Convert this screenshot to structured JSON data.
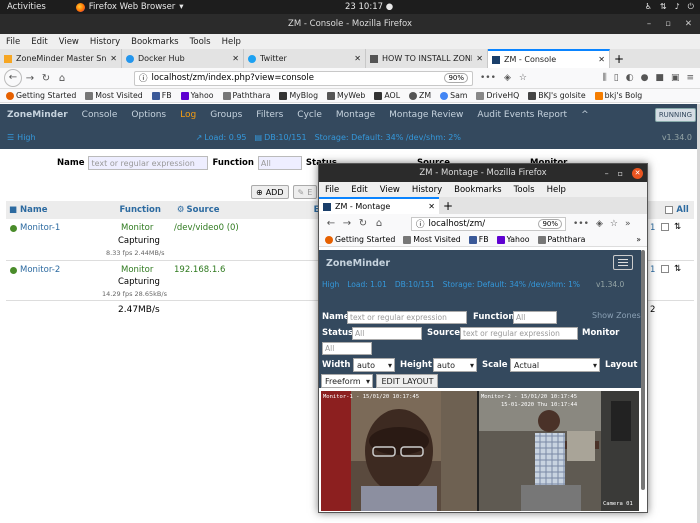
{
  "topbar": {
    "activities": "Activities",
    "app_name": "Firefox Web Browser",
    "clock": "23  10:17 ●",
    "tray_icons": [
      "accessibility-icon",
      "network-icon",
      "volume-icon",
      "power-icon"
    ]
  },
  "main_window": {
    "title": "ZM - Console - Mozilla Firefox",
    "menu": [
      "File",
      "Edit",
      "View",
      "History",
      "Bookmarks",
      "Tools",
      "Help"
    ],
    "tabs": [
      {
        "label": "ZoneMinder Master Snap",
        "active": false
      },
      {
        "label": "Docker Hub",
        "active": false
      },
      {
        "label": "Twitter",
        "active": false
      },
      {
        "label": "HOW TO INSTALL ZONE",
        "active": false
      },
      {
        "label": "ZM - Console",
        "active": true
      }
    ],
    "url": "localhost/zm/index.php?view=console",
    "zoom": "90%",
    "bookmarks": [
      {
        "label": "Getting Started",
        "color": "#e66000"
      },
      {
        "label": "Most Visited",
        "color": "#777777"
      },
      {
        "label": "FB",
        "color": "#3b5998"
      },
      {
        "label": "Yahoo",
        "color": "#5f01d1"
      },
      {
        "label": "Paththara",
        "color": "#777777"
      },
      {
        "label": "MyBlog",
        "color": "#333333"
      },
      {
        "label": "MyWeb",
        "color": "#555555"
      },
      {
        "label": "AOL",
        "color": "#333333"
      },
      {
        "label": "ZM",
        "color": "#555555"
      },
      {
        "label": "Sam",
        "color": "#4285f4"
      },
      {
        "label": "DriveHQ",
        "color": "#888888"
      },
      {
        "label": "BKJ's golsite",
        "color": "#444444"
      },
      {
        "label": "bkj's Bolg",
        "color": "#f57d00"
      }
    ]
  },
  "zm": {
    "brand": "ZoneMinder",
    "nav": [
      "Console",
      "Options",
      "Log",
      "Groups",
      "Filters",
      "Cycle",
      "Montage",
      "Montage Review",
      "Audit Events Report",
      "^"
    ],
    "running": "RUNNING",
    "status": {
      "state": "High",
      "load": "Load: 0.95",
      "db": "DB:10/151",
      "storage": "Storage: Default: 34% /dev/shm: 2%",
      "version": "v1.34.0"
    },
    "filter": {
      "name_label": "Name",
      "name_placeholder": "text or regular expression",
      "function_label": "Function",
      "function_placeholder": "All",
      "status_label": "Status",
      "source_label": "Source",
      "monitor_label": "Monitor"
    },
    "buttons": {
      "add": "ADD",
      "edit": "E"
    },
    "table": {
      "headers": {
        "name": "Name",
        "function": "Function",
        "source": "Source",
        "events": "E",
        "all": "All"
      },
      "rows": [
        {
          "name": "Monitor-1",
          "function": "Monitor",
          "state": "Capturing",
          "fps": "8.33 fps 2.44MB/s",
          "source": "/dev/video0 (0)",
          "count": "1"
        },
        {
          "name": "Monitor-2",
          "function": "Monitor",
          "state": "Capturing",
          "fps": "14.29 fps 28.65kB/s",
          "source": "192.168.1.6",
          "count": "1"
        }
      ],
      "total_bandwidth": "2.47MB/s",
      "total_count": "2"
    }
  },
  "montage_window": {
    "title": "ZM - Montage - Mozilla Firefox",
    "menu": [
      "File",
      "Edit",
      "View",
      "History",
      "Bookmarks",
      "Tools",
      "Help"
    ],
    "tab": "ZM - Montage",
    "url": "localhost/zm/",
    "zoom": "90%",
    "bookmarks": [
      "Getting Started",
      "Most Visited",
      "FB",
      "Yahoo",
      "Paththara"
    ],
    "brand": "ZoneMinder",
    "status": {
      "state": "High",
      "load": "Load: 1.01",
      "db": "DB:10/151",
      "storage": "Storage: Default: 34% /dev/shm: 1%",
      "version": "v1.34.0"
    },
    "form": {
      "name_label": "Name",
      "name_placeholder": "text or regular expression",
      "function_label": "Function",
      "function_placeholder": "All",
      "show_zones": "Show Zones",
      "status_label": "Status",
      "status_placeholder": "All",
      "source_label": "Source",
      "source_placeholder": "text or regular expression",
      "monitor_label": "Monitor",
      "monitor_placeholder": "All",
      "width_label": "Width",
      "width_value": "auto",
      "height_label": "Height",
      "height_value": "auto",
      "scale_label": "Scale",
      "scale_value": "Actual",
      "layout_label": "Layout",
      "layout_value": "Freeform",
      "edit_layout": "EDIT LAYOUT"
    },
    "feeds": [
      {
        "overlay": "Monitor-1 - 15/01/20 10:17:45"
      },
      {
        "overlay": "Monitor-2 - 15/01/20 10:17:45",
        "overlay2": "15-01-2020 Thu 10:17:44",
        "overlay3": "Camera 01"
      }
    ]
  }
}
